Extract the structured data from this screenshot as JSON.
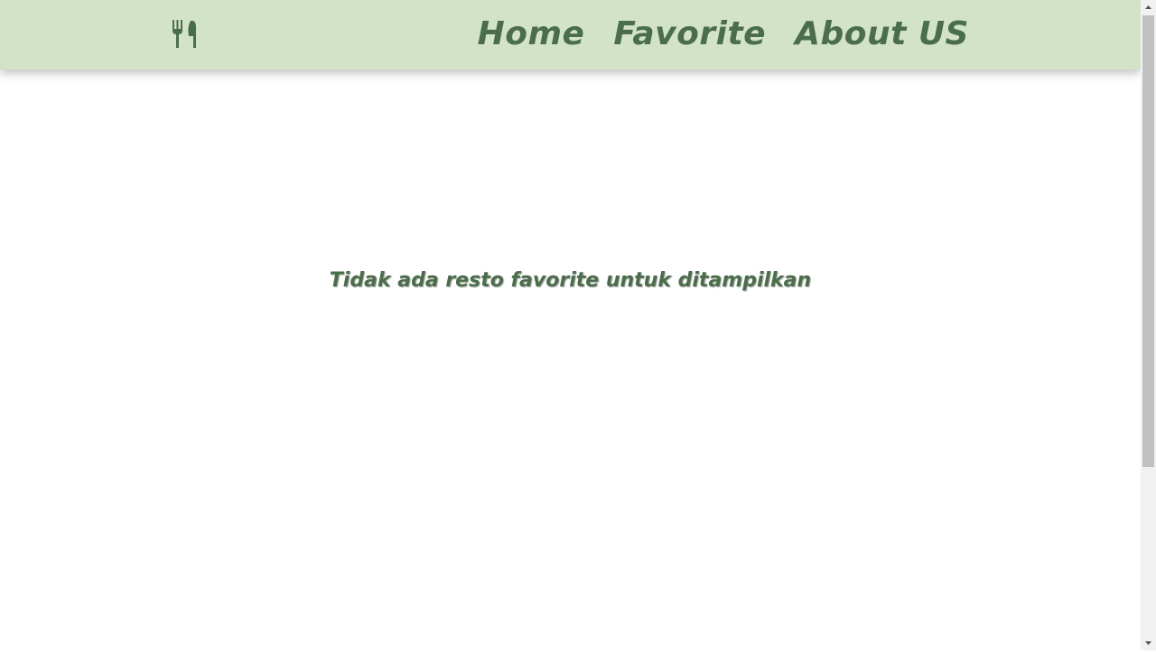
{
  "app_bar": {
    "logo_icon": "fork-knife-icon",
    "background": "#d3e3c7",
    "accent": "#4b6e4a"
  },
  "nav": {
    "items": [
      {
        "label": "Home"
      },
      {
        "label": "Favorite"
      },
      {
        "label": "About US"
      }
    ]
  },
  "main": {
    "empty_message": "Tidak ada resto favorite untuk ditampilkan"
  }
}
